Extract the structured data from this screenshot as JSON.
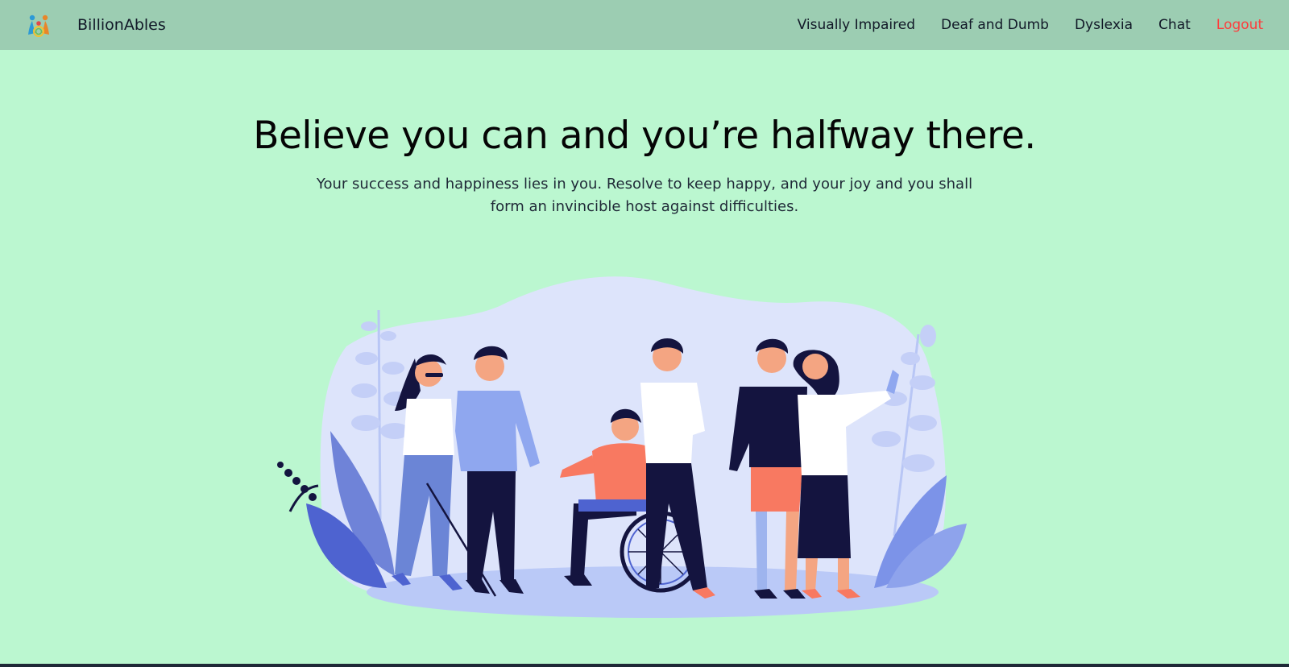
{
  "navbar": {
    "brand": "BillionAbles",
    "links": [
      {
        "label": "Visually Impaired"
      },
      {
        "label": "Deaf and Dumb"
      },
      {
        "label": "Dyslexia"
      },
      {
        "label": "Chat"
      },
      {
        "label": "Logout"
      }
    ]
  },
  "hero": {
    "title": "Believe you can and you’re halfway there.",
    "subtitle": "Your success and happiness lies in you. Resolve to keep happy, and your joy and you shall form an invincible host against difficulties."
  },
  "colors": {
    "page_background": "#bbf7d0",
    "navbar_background": "#9ccdb2",
    "logout": "#ff3b3b",
    "illustration_blob": "#dde4fb",
    "illustration_accent": "#7c93e8"
  },
  "illustration": {
    "icon": "people-with-disabilities-illustration"
  }
}
